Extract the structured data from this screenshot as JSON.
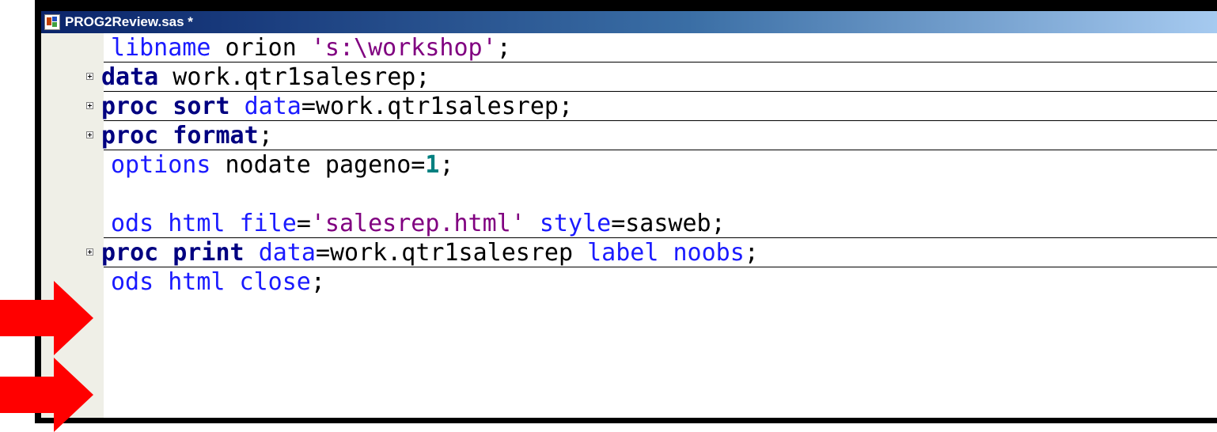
{
  "window": {
    "title": "PROG2Review.sas *",
    "icon": "sas-program-icon"
  },
  "code_lines": [
    {
      "tokens": [
        {
          "t": "libname",
          "c": "blue"
        },
        {
          "t": " orion ",
          "c": "blk"
        },
        {
          "t": "'s:\\workshop'",
          "c": "str"
        },
        {
          "t": ";",
          "c": "blk"
        }
      ],
      "fold": false,
      "separator": true
    },
    {
      "tokens": [
        {
          "t": "data",
          "c": "kw"
        },
        {
          "t": " work.qtr1salesrep;",
          "c": "blk"
        }
      ],
      "fold": true,
      "separator": true
    },
    {
      "tokens": [
        {
          "t": "proc sort",
          "c": "kw"
        },
        {
          "t": " ",
          "c": "blk"
        },
        {
          "t": "data",
          "c": "blue"
        },
        {
          "t": "=work.qtr1salesrep;",
          "c": "blk"
        }
      ],
      "fold": true,
      "separator": true
    },
    {
      "tokens": [
        {
          "t": "proc format",
          "c": "kw"
        },
        {
          "t": ";",
          "c": "blk"
        }
      ],
      "fold": true,
      "separator": true
    },
    {
      "tokens": [
        {
          "t": "options",
          "c": "blue"
        },
        {
          "t": " nodate pageno=",
          "c": "blk"
        },
        {
          "t": "1",
          "c": "num"
        },
        {
          "t": ";",
          "c": "blk"
        }
      ],
      "fold": false,
      "separator": false
    },
    {
      "tokens": [],
      "fold": false,
      "separator": false
    },
    {
      "tokens": [
        {
          "t": "ods html",
          "c": "blue"
        },
        {
          "t": " ",
          "c": "blk"
        },
        {
          "t": "file",
          "c": "blue"
        },
        {
          "t": "=",
          "c": "blk"
        },
        {
          "t": "'salesrep.html'",
          "c": "str"
        },
        {
          "t": " ",
          "c": "blk"
        },
        {
          "t": "style",
          "c": "blue"
        },
        {
          "t": "=sasweb;",
          "c": "blk"
        }
      ],
      "fold": false,
      "separator": true
    },
    {
      "tokens": [
        {
          "t": "proc print",
          "c": "kw"
        },
        {
          "t": " ",
          "c": "blk"
        },
        {
          "t": "data",
          "c": "blue"
        },
        {
          "t": "=work.qtr1salesrep ",
          "c": "blk"
        },
        {
          "t": "label noobs",
          "c": "blue"
        },
        {
          "t": ";",
          "c": "blk"
        }
      ],
      "fold": true,
      "separator": true
    },
    {
      "tokens": [
        {
          "t": "ods html close",
          "c": "blue"
        },
        {
          "t": ";",
          "c": "blk"
        }
      ],
      "fold": false,
      "separator": false
    }
  ],
  "annotations": {
    "arrow_color": "#ff0000",
    "arrows": [
      "arrow-to-ods-html-file",
      "arrow-to-ods-html-close"
    ]
  }
}
